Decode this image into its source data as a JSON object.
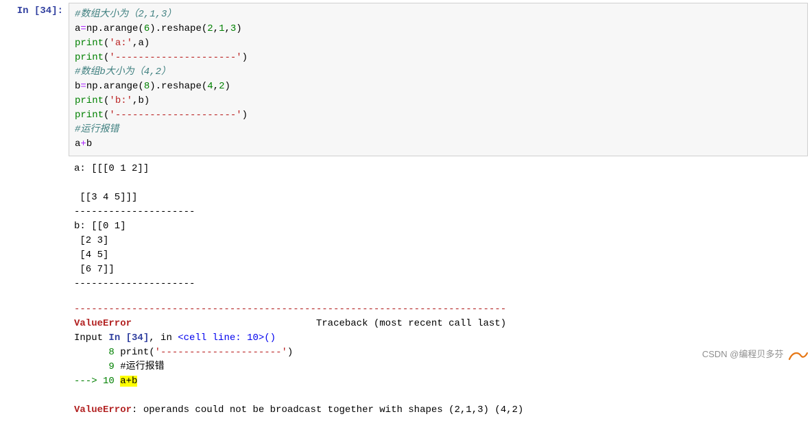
{
  "prompt": {
    "label": "In  [34]:"
  },
  "code": {
    "l1": "#数组大小为（2,1,3）",
    "l2_a": "a",
    "l2_eq": "=",
    "l2_np": "np.arange(",
    "l2_n1": "6",
    "l2_close": ").reshape(",
    "l2_n2": "2",
    "l2_c1": ",",
    "l2_n3": "1",
    "l2_c2": ",",
    "l2_n4": "3",
    "l2_end": ")",
    "l3_p": "print",
    "l3_o": "(",
    "l3_s": "'a:'",
    "l3_c": ",",
    "l3_a": "a",
    "l3_e": ")",
    "l4_p": "print",
    "l4_o": "(",
    "l4_s": "'---------------------'",
    "l4_e": ")",
    "l5": "#数组b大小为（4,2）",
    "l6_a": "b",
    "l6_eq": "=",
    "l6_np": "np.arange(",
    "l6_n1": "8",
    "l6_close": ").reshape(",
    "l6_n2": "4",
    "l6_c1": ",",
    "l6_n3": "2",
    "l6_end": ")",
    "l7_p": "print",
    "l7_o": "(",
    "l7_s": "'b:'",
    "l7_c": ",",
    "l7_a": "b",
    "l7_e": ")",
    "l8_p": "print",
    "l8_o": "(",
    "l8_s": "'---------------------'",
    "l8_e": ")",
    "l9": "#运行报错",
    "l10_a": "a",
    "l10_op": "+",
    "l10_b": "b"
  },
  "output": {
    "text": "a: [[[0 1 2]]\n\n [[3 4 5]]]\n---------------------\nb: [[0 1]\n [2 3]\n [4 5]\n [6 7]]\n---------------------\n"
  },
  "error": {
    "hr": "---------------------------------------------------------------------------",
    "name": "ValueError",
    "traceback": "                                Traceback (most recent call last)",
    "input_pre": "Input ",
    "input_in": "In [34]",
    "input_mid": ", in ",
    "cell_line": "<cell line: 10>",
    "paren": "()",
    "l8_no": "      8 ",
    "l8_p": "print",
    "l8_o": "(",
    "l8_s": "'---------------------'",
    "l8_e": ")",
    "l9_no": "      9 ",
    "l9_txt": "#运行报错",
    "arrow": "---> ",
    "l10_no": "10 ",
    "l10_code": "a+b",
    "msg": ": operands could not be broadcast together with shapes (2,1,3) (4,2) "
  },
  "watermark": "CSDN @编程贝多芬"
}
